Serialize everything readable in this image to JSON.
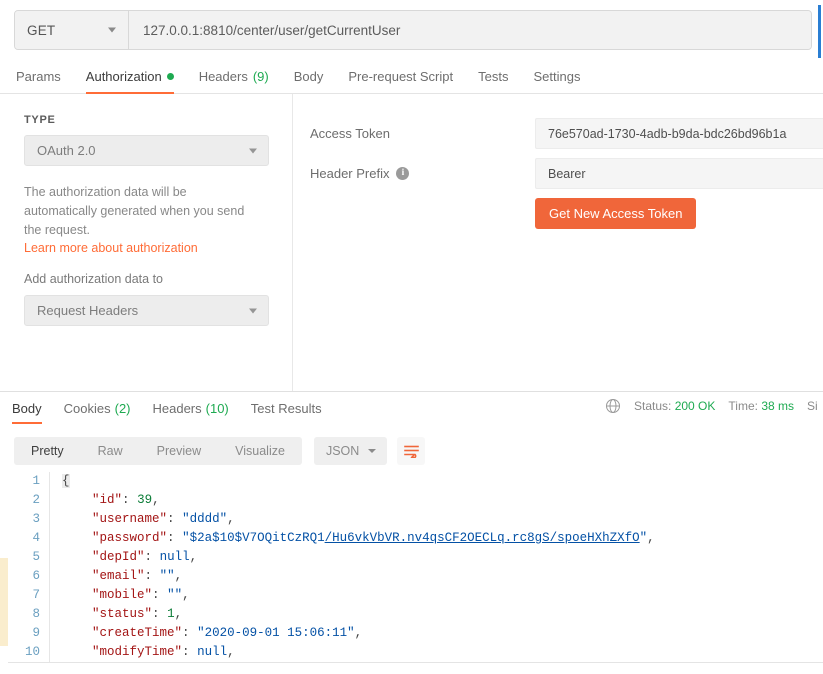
{
  "request": {
    "method": "GET",
    "url": "127.0.0.1:8810/center/user/getCurrentUser",
    "tabs": [
      {
        "label": "Params",
        "suffix": "",
        "active": false,
        "dot": false
      },
      {
        "label": "Authorization",
        "suffix": "",
        "active": true,
        "dot": true
      },
      {
        "label": "Headers",
        "suffix": "(9)",
        "active": false,
        "dot": false
      },
      {
        "label": "Body",
        "suffix": "",
        "active": false,
        "dot": false
      },
      {
        "label": "Pre-request Script",
        "suffix": "",
        "active": false,
        "dot": false
      },
      {
        "label": "Tests",
        "suffix": "",
        "active": false,
        "dot": false
      },
      {
        "label": "Settings",
        "suffix": "",
        "active": false,
        "dot": false
      }
    ]
  },
  "auth": {
    "type_label": "TYPE",
    "type_value": "OAuth 2.0",
    "description": "The authorization data will be automatically generated when you send the request.",
    "learn_more": "Learn more about authorization",
    "add_data_label": "Add authorization data to",
    "add_data_value": "Request Headers",
    "access_token_label": "Access Token",
    "access_token_value": "76e570ad-1730-4adb-b9da-bdc26bd96b1a",
    "header_prefix_label": "Header Prefix",
    "header_prefix_value": "Bearer",
    "info_glyph": "i",
    "get_token_button": "Get New Access Token"
  },
  "response": {
    "tabs": [
      {
        "label": "Body",
        "suffix": "",
        "active": true
      },
      {
        "label": "Cookies",
        "suffix": "(2)",
        "active": false
      },
      {
        "label": "Headers",
        "suffix": "(10)",
        "active": false
      },
      {
        "label": "Test Results",
        "suffix": "",
        "active": false
      }
    ],
    "status_label": "Status:",
    "status_value": "200 OK",
    "time_label": "Time:",
    "time_value": "38 ms",
    "size_label": "Si",
    "globe_icon": "globe-icon"
  },
  "viewer": {
    "modes": [
      {
        "label": "Pretty",
        "active": true
      },
      {
        "label": "Raw",
        "active": false
      },
      {
        "label": "Preview",
        "active": false
      },
      {
        "label": "Visualize",
        "active": false
      }
    ],
    "format": "JSON",
    "wrap_icon": "wrap-text-icon"
  },
  "body": {
    "line_numbers": [
      "1",
      "2",
      "3",
      "4",
      "5",
      "6",
      "7",
      "8",
      "9",
      "10"
    ],
    "json": {
      "id": 39,
      "username": "dddd",
      "password": "$2a$10$V7OQitCzRQ1/Hu6vkVbVR.nv4qsCF2OECLq.rc8gS/spoeHXhZXfO",
      "depId": null,
      "email": "",
      "mobile": "",
      "status": 1,
      "createTime": "2020-09-01 15:06:11",
      "modifyTime": null
    }
  },
  "colors": {
    "accent_orange": "#ff6c37",
    "button_orange": "#f0663a",
    "status_green": "#1eaa51",
    "right_accent_blue": "#2a7ed3",
    "left_accent_cream": "#faedcd"
  }
}
